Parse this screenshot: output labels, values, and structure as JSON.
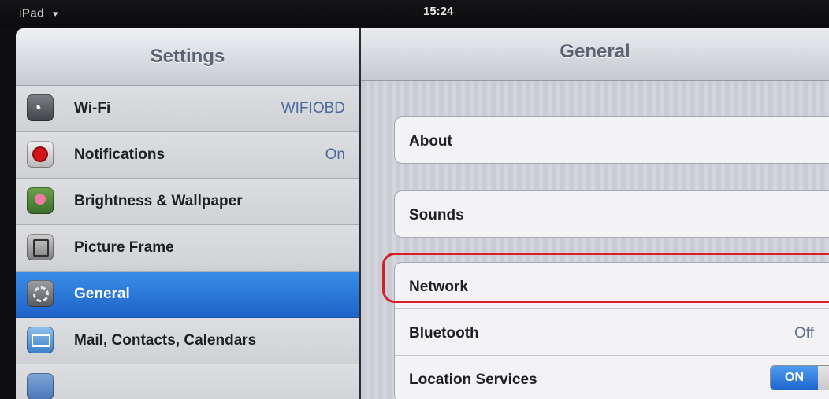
{
  "status_bar": {
    "device": "iPad",
    "time": "15:24"
  },
  "sidebar": {
    "title": "Settings",
    "items": [
      {
        "label": "Wi-Fi",
        "value": "WIFIOBD",
        "icon": "wifi-icon"
      },
      {
        "label": "Notifications",
        "value": "On",
        "icon": "notifications-icon"
      },
      {
        "label": "Brightness & Wallpaper",
        "value": "",
        "icon": "brightness-wallpaper-icon"
      },
      {
        "label": "Picture Frame",
        "value": "",
        "icon": "picture-frame-icon"
      },
      {
        "label": "General",
        "value": "",
        "icon": "gear-icon",
        "selected": true
      },
      {
        "label": "Mail, Contacts, Calendars",
        "value": "",
        "icon": "mail-icon"
      }
    ]
  },
  "detail": {
    "title": "General",
    "group1": [
      {
        "label": "About"
      }
    ],
    "group2": [
      {
        "label": "Sounds"
      }
    ],
    "group3": [
      {
        "label": "Network",
        "highlighted": true
      },
      {
        "label": "Bluetooth",
        "value": "Off"
      },
      {
        "label": "Location Services",
        "toggle": "ON"
      }
    ]
  },
  "colors": {
    "selected_row": "#1e63c8",
    "highlight_outline": "#dd1d27",
    "toggle_on": "#1f65cf"
  }
}
